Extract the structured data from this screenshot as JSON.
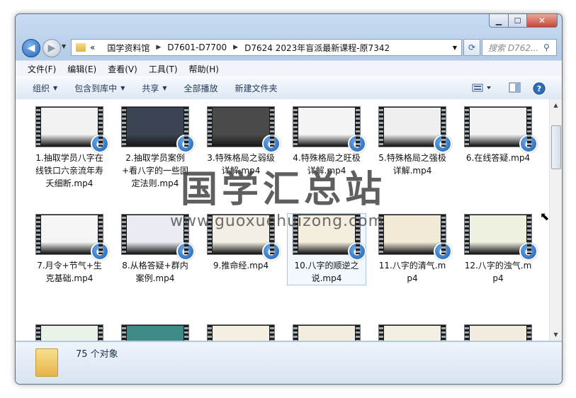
{
  "window": {
    "buttons": {
      "minimize": "▁",
      "maximize": "☐",
      "close": "✕"
    }
  },
  "nav": {
    "back_glyph": "◀",
    "forward_glyph": "▶",
    "breadcrumb": [
      "国学资料馆",
      "D7601-D7700",
      "D7624 2023年盲派最新课程-原7342"
    ],
    "overflow": "«",
    "search_placeholder": "搜索 D762...",
    "search_icon": "search-icon",
    "refresh_icon": "refresh-icon"
  },
  "menu": [
    "文件(F)",
    "编辑(E)",
    "查看(V)",
    "工具(T)",
    "帮助(H)"
  ],
  "toolbar": {
    "organize": "组织",
    "include_in_library": "包含到库中",
    "share": "共享",
    "play_all": "全部播放",
    "new_folder": "新建文件夹"
  },
  "files": [
    {
      "name": "1.抽取学员八字在线铁口六亲流年寿夭细断.mp4",
      "bg": "#f2f2f2"
    },
    {
      "name": "2.抽取学员案例+看八字的一些固定法则.mp4",
      "bg": "#3a4452"
    },
    {
      "name": "3.特殊格局之弱级详解.mp4",
      "bg": "#4a4a4a"
    },
    {
      "name": "4.特殊格局之旺极详解.mp4",
      "bg": "#f4f4f4"
    },
    {
      "name": "5.特殊格局之强极详解.mp4",
      "bg": "#efefef"
    },
    {
      "name": "6.在线答疑.mp4",
      "bg": "#f3f3f3"
    },
    {
      "name": "7.月令+节气+生克基础.mp4",
      "bg": "#f5f5f5"
    },
    {
      "name": "8.从格答疑+群内案例.mp4",
      "bg": "#e9edf3"
    },
    {
      "name": "9.推命经.mp4",
      "bg": "#f3efe4"
    },
    {
      "name": "10.八字的顺逆之说.mp4",
      "bg": "#f3eedd"
    },
    {
      "name": "11.八字的清气.mp4",
      "bg": "#f1ead6"
    },
    {
      "name": "12.八字的浊气.mp4",
      "bg": "#eef0e0"
    },
    {
      "name": "",
      "bg": "#eaf3e8"
    },
    {
      "name": "",
      "bg": "#3e8a86"
    },
    {
      "name": "",
      "bg": "#f4efe2"
    },
    {
      "name": "",
      "bg": "#f3ede0"
    },
    {
      "name": "",
      "bg": "#f4efe3"
    },
    {
      "name": "",
      "bg": "#f2ecdf"
    }
  ],
  "status": {
    "count": "75 个对象"
  },
  "watermark": {
    "title": "国学汇总站",
    "url": "www.guoxuehuizong.com"
  }
}
